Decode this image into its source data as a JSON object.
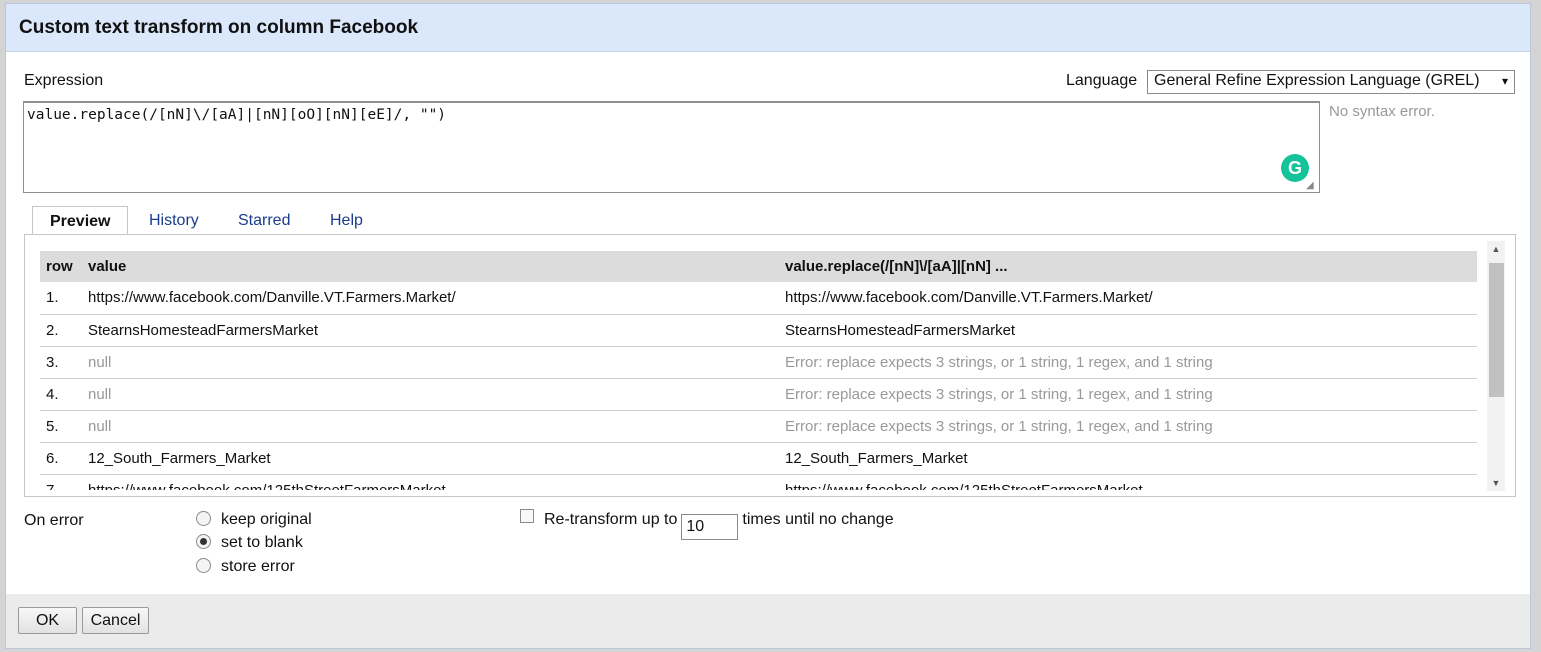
{
  "dialog": {
    "title": "Custom text transform on column Facebook"
  },
  "expression": {
    "label": "Expression",
    "value": "value.replace(/[nN]\\/[aA]|[nN][oO][nN][eE]/, \"\")",
    "syntax_status": "No syntax error."
  },
  "language": {
    "label": "Language",
    "selected": "General Refine Expression Language (GREL)",
    "caret": "▾"
  },
  "tabs": [
    {
      "label": "Preview",
      "active": true
    },
    {
      "label": "History",
      "active": false
    },
    {
      "label": "Starred",
      "active": false
    },
    {
      "label": "Help",
      "active": false
    }
  ],
  "preview": {
    "columns": [
      "row",
      "value",
      "value.replace(/[nN]\\/[aA]|[nN] ..."
    ],
    "rows": [
      {
        "row": "1.",
        "value": "https://www.facebook.com/Danville.VT.Farmers.Market/",
        "result": "https://www.facebook.com/Danville.VT.Farmers.Market/"
      },
      {
        "row": "2.",
        "value": "StearnsHomesteadFarmersMarket",
        "result": "StearnsHomesteadFarmersMarket"
      },
      {
        "row": "3.",
        "value": "null",
        "result": "Error: replace expects 3 strings, or 1 string, 1 regex, and 1 string"
      },
      {
        "row": "4.",
        "value": "null",
        "result": "Error: replace expects 3 strings, or 1 string, 1 regex, and 1 string"
      },
      {
        "row": "5.",
        "value": "null",
        "result": "Error: replace expects 3 strings, or 1 string, 1 regex, and 1 string"
      },
      {
        "row": "6.",
        "value": "12_South_Farmers_Market",
        "result": "12_South_Farmers_Market"
      },
      {
        "row": "7.",
        "value": "https://www.facebook.com/125thStreetFarmersMarket",
        "result": "https://www.facebook.com/125thStreetFarmersMarket"
      }
    ]
  },
  "on_error": {
    "label": "On error",
    "options": [
      {
        "label": "keep original",
        "checked": false
      },
      {
        "label": "set to blank",
        "checked": true
      },
      {
        "label": "store error",
        "checked": false
      }
    ]
  },
  "retransform": {
    "checked": false,
    "label_before": "Re-transform up to",
    "times_value": "10",
    "label_after": "times until no change"
  },
  "buttons": {
    "ok": "OK",
    "cancel": "Cancel"
  },
  "icons": {
    "grammarly": "G"
  }
}
